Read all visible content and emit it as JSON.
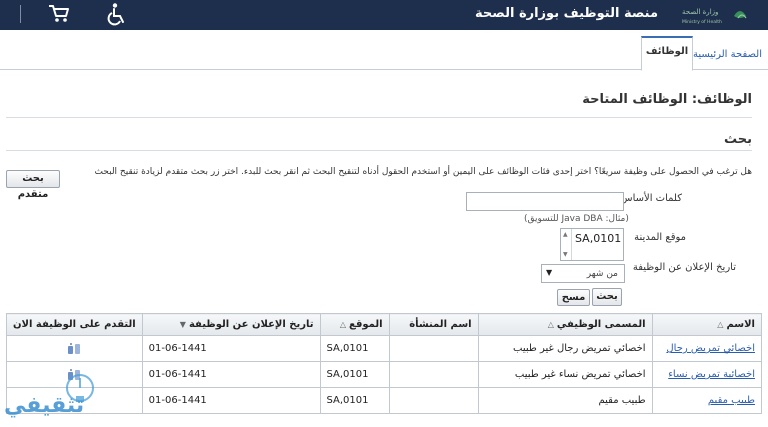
{
  "header": {
    "portal_title": "منصة التوظيف بوزارة الصحة",
    "logo_text": "وزارة الصحة Ministry of Health"
  },
  "tabs": [
    {
      "label": "الصفحة الرئيسية",
      "active": false
    },
    {
      "label": "الوظائف",
      "active": true
    }
  ],
  "page": {
    "title": "الوظائف: الوظائف المتاحة",
    "search_title": "بحث",
    "instruction": "هل ترغب في الحصول على وظيفة سريعًا؟ اختر إحدى فئات الوظائف على اليمين أو استخدم الحقول أدناه لتنقيح البحث ثم انقر بحث للبدء. اختر زر بحث متقدم لزيادة تنقيح البحث"
  },
  "search": {
    "advanced_label": "بحث متقدم",
    "keywords_label": "كلمات الأساس",
    "keywords_value": "",
    "keywords_hint": "(مثال: Java DBA للتسويق)",
    "city_label": "موقع المدينة",
    "city_value": "SA,0101",
    "date_label": "تاريخ الإعلان عن الوظيفة",
    "date_value": "من شهر",
    "search_label": "بحث",
    "clear_label": "مسح"
  },
  "table": {
    "columns": [
      "الاسم",
      "المسمى الوظيفي",
      "اسم المنشأة",
      "الموقع",
      "تاريخ الإعلان عن الوظيفة",
      "التقدم على الوظيفة الان"
    ],
    "rows": [
      {
        "name": "اخصائي تمريض رجال",
        "title": "اخصائي تمريض رجال غير طبيب",
        "org": "",
        "location": "SA,0101",
        "date": "01-06-1441"
      },
      {
        "name": "اخصائية تمريض نساء",
        "title": "اخصائي تمريض نساء غير طبيب",
        "org": "",
        "location": "SA,0101",
        "date": "01-06-1441"
      },
      {
        "name": "طبيب مقيم",
        "title": "طبيب مقيم",
        "org": "",
        "location": "SA,0101",
        "date": "01-06-1441"
      }
    ]
  },
  "watermark": {
    "text": "تثقيفي"
  },
  "colors": {
    "header_bg": "#1d2f4c",
    "link": "#2a5db0",
    "border": "#c2c8cf"
  },
  "icons": [
    "accessibility-icon",
    "shopping-cart-icon",
    "apply-job-icon"
  ]
}
